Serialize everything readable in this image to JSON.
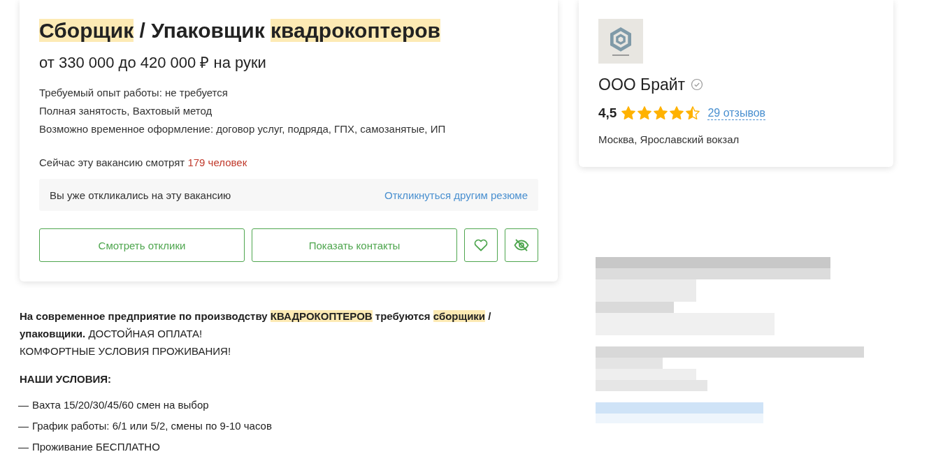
{
  "vacancy": {
    "title": [
      {
        "text": "Сборщик",
        "highlighted": true
      },
      {
        "text": " / Упаковщик ",
        "highlighted": false
      },
      {
        "text": "квадрокоптеров",
        "highlighted": true
      }
    ],
    "salary": "от 330 000 до 420 000 ₽ на руки",
    "details": [
      "Требуемый опыт работы: не требуется",
      "Полная занятость, Вахтовый метод",
      "Возможно временное оформление: договор услуг, подряда, ГПХ, самозанятые, ИП"
    ],
    "viewers": {
      "text": "Сейчас эту вакансию смотрят",
      "count": "179 человек"
    },
    "response_notice": {
      "text": "Вы уже откликались на эту вакансию",
      "link": "Откликнуться другим резюме"
    },
    "buttons": [
      {
        "kind": "text",
        "label": "Смотреть отклики"
      },
      {
        "kind": "text",
        "label": "Показать контакты"
      },
      {
        "kind": "favorite"
      },
      {
        "kind": "hide"
      }
    ]
  },
  "company": {
    "name": "ООО Брайт",
    "verified": true,
    "rating": "4,5",
    "stars": 4.5,
    "reviews": "29 отзывов",
    "address": "Москва, Ярославский вокзал"
  },
  "description": {
    "intro": [
      {
        "text": "На современное предприятие по производству ",
        "bold": true,
        "highlighted": false
      },
      {
        "text": "КВАДРОКОПТЕРОВ",
        "bold": true,
        "highlighted": true
      },
      {
        "text": " требуются ",
        "bold": true,
        "highlighted": false
      },
      {
        "text": "сборщики",
        "bold": true,
        "highlighted": true
      },
      {
        "text": " / упаковщики.",
        "bold": true,
        "highlighted": false
      },
      {
        "text": " ДОСТОЙНАЯ ОПЛАТА!",
        "bold": false,
        "highlighted": false
      }
    ],
    "line": "КОМФОРТНЫЕ УСЛОВИЯ ПРОЖИВАНИЯ!",
    "heading": "НАШИ УСЛОВИЯ:",
    "conditions": [
      "Вахта 15/20/30/45/60 смен на выбор",
      "График работы: 6/1 или 5/2, смены по 9-10 часов",
      "Проживание БЕСПЛАТНО"
    ],
    "bullet": "—"
  }
}
